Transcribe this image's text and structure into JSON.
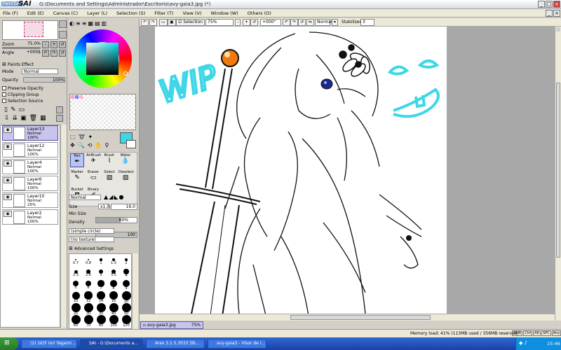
{
  "app": {
    "logo_small": "PaintTool",
    "logo_big": "SAI",
    "title": "G:\\Documents and Settings\\Administrador\\Escritorio\\avy-gaia3.jpg (*)"
  },
  "menu": [
    "File (F)",
    "Edit (E)",
    "Canvas (C)",
    "Layer (L)",
    "Selection (S)",
    "Filter (T)",
    "View (V)",
    "Window (W)",
    "Others (O)"
  ],
  "navigator": {
    "zoom_label": "Zoom",
    "zoom_value": "75.0%",
    "angle_label": "Angle",
    "angle_value": "+000$"
  },
  "layer_props": {
    "paints_effect": "Paints Effect",
    "mode_label": "Mode",
    "mode_value": "Normal",
    "opacity_label": "Opacity",
    "opacity_value": "100%",
    "preserve_opacity": "Preserve Opacity",
    "clipping_group": "Clipping Group",
    "selection_source": "Selection Source"
  },
  "layers": [
    {
      "name": "Layer13",
      "mode": "Normal",
      "opacity": "100%",
      "selected": true
    },
    {
      "name": "Layer12",
      "mode": "Normal",
      "opacity": "100%",
      "selected": false
    },
    {
      "name": "Layer4",
      "mode": "Normal",
      "opacity": "100%",
      "selected": false
    },
    {
      "name": "Layer6",
      "mode": "Normal",
      "opacity": "100%",
      "selected": false
    },
    {
      "name": "Layer10",
      "mode": "Normal",
      "opacity": "25%",
      "selected": false
    },
    {
      "name": "Layer2",
      "mode": "Normal",
      "opacity": "100%",
      "selected": false
    }
  ],
  "tools": {
    "row1": [
      "Pen",
      "AirBrush",
      "Brush",
      "Water"
    ],
    "row2": [
      "Marker",
      "Eraser",
      "Select",
      "Deselect"
    ],
    "row3": [
      "Bucket",
      "Binary"
    ]
  },
  "brush": {
    "mode_value": "Normal",
    "size_label": "Size",
    "size_mult": "x1.0",
    "size_value": "16.0",
    "minsize_label": "Min Size",
    "minsize_value": "60%",
    "minsize_fraction": 0.6,
    "density_label": "Density",
    "density_value": "100",
    "density_fraction": 1.0,
    "shape": "(simple circle)",
    "texture": "(no texture)",
    "advanced": "Advanced Settings"
  },
  "brush_sizes": [
    "0.7",
    "0.8",
    "1",
    "1.5",
    "2",
    "2.3",
    "2.6",
    "3",
    "3.5",
    "4",
    "5",
    "6",
    "7",
    "8",
    "9",
    "10",
    "12",
    "14",
    "16",
    "20",
    "25",
    "30",
    "35",
    "40",
    "50",
    "60",
    "70",
    "80",
    "100",
    "120"
  ],
  "canvas_toolbar": {
    "selection_label": "Selection",
    "zoom_value": "75%",
    "angle_value": "+000°",
    "mode_value": "Normal",
    "stabilizer_label": "Stabilizer",
    "stabilizer_value": "3"
  },
  "canvas_text": {
    "wip": "WIP"
  },
  "doc_tab": {
    "name": "avy-gaia3.jpg",
    "zoom": "75%"
  },
  "status": {
    "memory": "Memory load: 41% (113MB used / 356MB reserved)",
    "keys": [
      "Shift",
      "Ctrl",
      "Alt",
      "SPC",
      "Any"
    ]
  },
  "taskbar": {
    "items": [
      "(2) (st)F Iori Yagami ...",
      "SAI - G:\\Documents a...",
      "Ares 3.1.5.3033 [Bi...",
      "avy-gaia3 - Visor de i..."
    ],
    "clock": "15:46"
  },
  "colors": {
    "accent": "#c8c4ee",
    "wip_cyan": "#3ed7e8",
    "current_color": "#3ed7e8"
  }
}
